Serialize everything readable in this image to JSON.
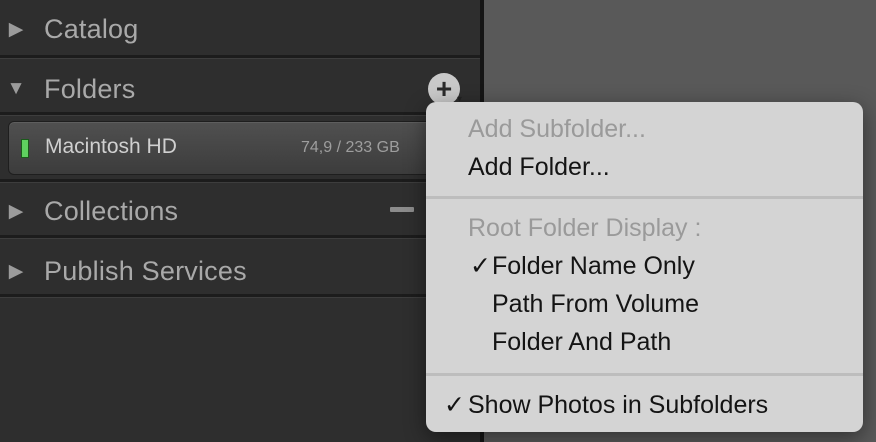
{
  "sections": [
    {
      "label": "Catalog",
      "expanded": false
    },
    {
      "label": "Folders",
      "expanded": true
    },
    {
      "label": "Collections",
      "expanded": false
    },
    {
      "label": "Publish Services",
      "expanded": false
    }
  ],
  "icons": {
    "collapsed": "▶",
    "expanded": "▼",
    "add": "+",
    "add_caret": "▾",
    "checkmark": "✓"
  },
  "volume": {
    "name": "Macintosh HD",
    "usage": "74,9 / 233 GB",
    "status_color": "#5fd05f"
  },
  "menu": {
    "add_subfolder": "Add Subfolder...",
    "add_folder": "Add Folder...",
    "root_display_heading": "Root Folder Display :",
    "folder_name_only": "Folder Name Only",
    "path_from_volume": "Path From Volume",
    "folder_and_path": "Folder And Path",
    "show_photos_in_subfolders": "Show Photos in Subfolders"
  }
}
